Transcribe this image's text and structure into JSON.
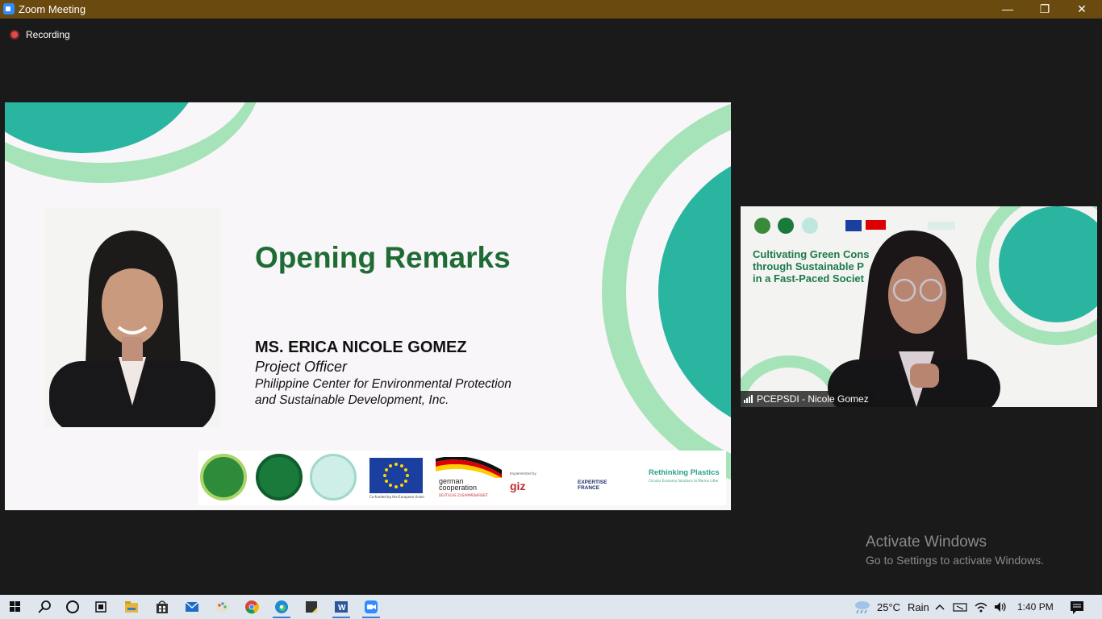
{
  "window": {
    "title": "Zoom Meeting",
    "minimize_glyph": "—",
    "restore_glyph": "❐",
    "close_glyph": "✕"
  },
  "recording": {
    "label": "Recording"
  },
  "slide": {
    "title": "Opening Remarks",
    "speaker_name": "MS. ERICA NICOLE GOMEZ",
    "speaker_role": "Project Officer",
    "organization_line1": "Philippine Center for Environmental Protection",
    "organization_line2": "and Sustainable Development, Inc.",
    "colors": {
      "teal": "#2ab5a0",
      "mint": "#a6e3b8",
      "title_green": "#1f6b34"
    },
    "logos": {
      "eu_caption": "Co-funded by the European Union",
      "german_line1": "german",
      "german_line2": "cooperation",
      "german_sub": "DEUTSCHE ZUSAMMENARBEIT",
      "giz_small": "Implemented by",
      "giz": "giz",
      "ef_line1": "EXPERTISE",
      "ef_line2": "FRANCE",
      "rp_title": "Rethinking Plastics",
      "rp_sub": "Circular Economy Solutions to Marine Litter"
    }
  },
  "video": {
    "participant_name": "PCEPSDI - Nicole Gomez",
    "background_title_line1": "Cultivating Green Cons",
    "background_title_line2": "through Sustainable P",
    "background_title_line3": "in a Fast-Paced Societ"
  },
  "watermark": {
    "heading": "Activate Windows",
    "subtext": "Go to Settings to activate Windows."
  },
  "taskbar": {
    "icons": [
      "windows-start-icon",
      "search-icon",
      "cortana-icon",
      "task-view-icon",
      "file-explorer-icon",
      "store-icon",
      "mail-icon",
      "paint-icon",
      "chrome-icon",
      "edge-icon",
      "sticky-notes-icon",
      "word-icon",
      "zoom-icon"
    ],
    "weather_temp": "25°C",
    "weather_desc": "Rain",
    "time": "1:40 PM"
  }
}
